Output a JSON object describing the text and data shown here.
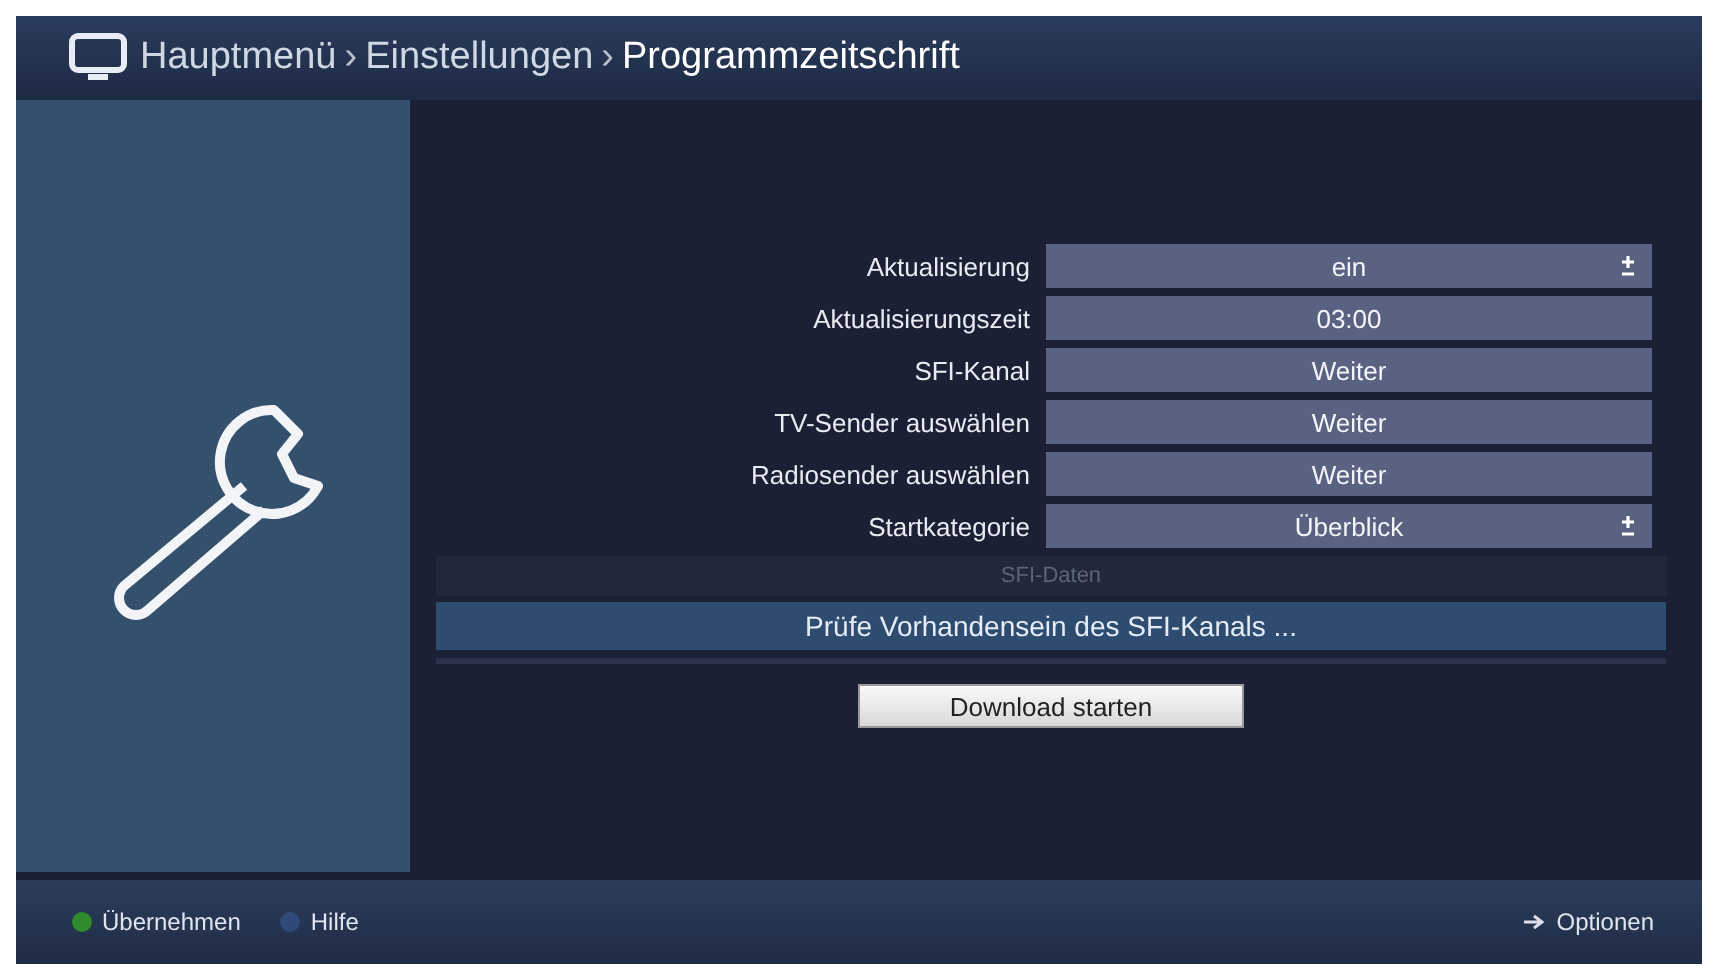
{
  "header": {
    "breadcrumb": [
      "Hauptmenü",
      "Einstellungen",
      "Programmzeitschrift"
    ],
    "separator": "›"
  },
  "settings": [
    {
      "label": "Aktualisierung",
      "value": "ein",
      "kind": "select"
    },
    {
      "label": "Aktualisierungszeit",
      "value": "03:00",
      "kind": "field"
    },
    {
      "label": "SFI-Kanal",
      "value": "Weiter",
      "kind": "field"
    },
    {
      "label": "TV-Sender auswählen",
      "value": "Weiter",
      "kind": "field"
    },
    {
      "label": "Radiosender auswählen",
      "value": "Weiter",
      "kind": "field"
    },
    {
      "label": "Startkategorie",
      "value": "Überblick",
      "kind": "select"
    }
  ],
  "status": {
    "title": "SFI-Daten",
    "message": "Prüfe Vorhandensein des SFI-Kanals ..."
  },
  "action_button": "Download starten",
  "footer": [
    {
      "label": "Übernehmen",
      "color": "#2e8b2e",
      "kind": "key"
    },
    {
      "label": "Hilfe",
      "color": "#2f4a78",
      "kind": "key"
    },
    {
      "label": "Optionen",
      "kind": "menu"
    }
  ]
}
